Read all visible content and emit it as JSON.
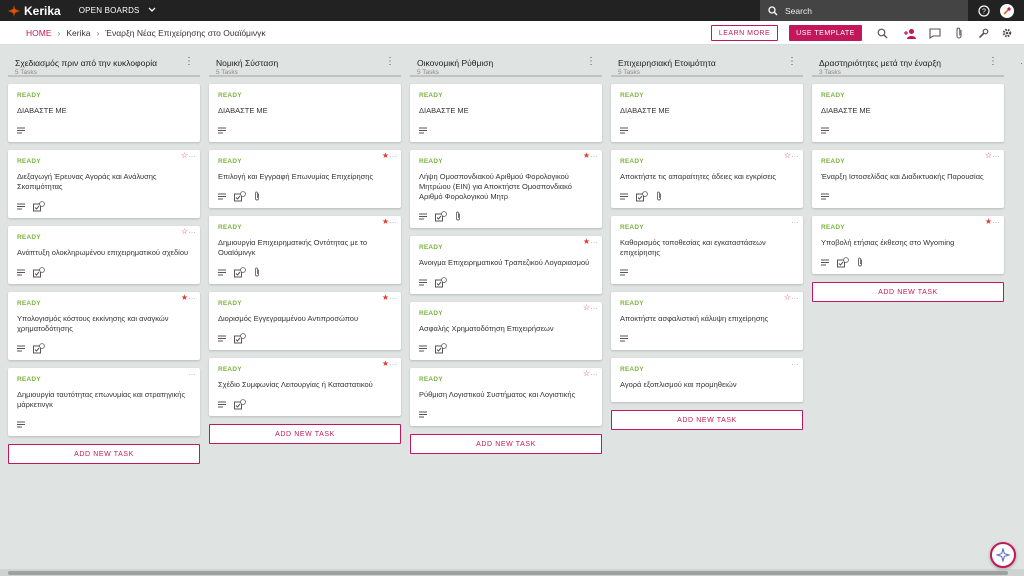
{
  "topbar": {
    "logo": "Kerika",
    "open_boards": "OPEN BOARDS",
    "search_placeholder": "Search"
  },
  "breadcrumb": {
    "home": "HOME",
    "workspace": "Kerika",
    "board": "Έναρξη Νέας Επιχείρησης στο Ουαϊόμινγκ"
  },
  "header_buttons": {
    "learn_more": "LEARN MORE",
    "use_template": "USE TEMPLATE"
  },
  "colors": {
    "accent": "#c2185b",
    "ready": "#7cb342",
    "star_filled": "#e53935"
  },
  "columns": [
    {
      "title": "Σχεδιασμός πριν από την κυκλοφορία",
      "count": "5 Tasks",
      "add_task": "ADD NEW TASK",
      "cards": [
        {
          "status": "READY",
          "title": "ΔΙΑΒΑΣΤΕ ΜΕ",
          "star": "none",
          "icons": [
            "desc"
          ]
        },
        {
          "status": "READY",
          "title": "Διεξαγωγή Έρευνας Αγοράς και Ανάλυσης Σκοπιμότητας",
          "star": "outline",
          "icons": [
            "desc",
            "checklist"
          ]
        },
        {
          "status": "READY",
          "title": "Ανάπτυξη ολοκληρωμένου επιχειρηματικού σχεδίου",
          "star": "outline",
          "icons": [
            "desc",
            "checklist"
          ]
        },
        {
          "status": "READY",
          "title": "Υπολογισμός κόστους εκκίνησης και αναγκών χρηματοδότησης",
          "star": "filled",
          "icons": [
            "desc",
            "checklist"
          ]
        },
        {
          "status": "READY",
          "title": "Δημιουργία ταυτότητας επωνυμίας και στρατηγικής μάρκετινγκ",
          "star": "none",
          "icons": [
            "desc"
          ]
        }
      ]
    },
    {
      "title": "Νομική Σύσταση",
      "count": "5 Tasks",
      "add_task": "ADD NEW TASK",
      "cards": [
        {
          "status": "READY",
          "title": "ΔΙΑΒΑΣΤΕ ΜΕ",
          "star": "none",
          "icons": [
            "desc"
          ]
        },
        {
          "status": "READY",
          "title": "Επιλογή και Εγγραφή Επωνυμίας Επιχείρησης",
          "star": "filled",
          "icons": [
            "desc",
            "checklist",
            "attach"
          ]
        },
        {
          "status": "READY",
          "title": "Δημιουργία Επιχειρηματικής Οντότητας με το Ουαϊόμινγκ",
          "star": "filled",
          "icons": [
            "desc",
            "checklist",
            "attach"
          ]
        },
        {
          "status": "READY",
          "title": "Διορισμός Εγγεγραμμένου Αντιπροσώπου",
          "star": "filled",
          "icons": [
            "desc",
            "checklist"
          ]
        },
        {
          "status": "READY",
          "title": "Σχέδιο Συμφωνίας Λειτουργίας ή Καταστατικού",
          "star": "filled",
          "icons": [
            "desc",
            "checklist"
          ]
        }
      ]
    },
    {
      "title": "Οικονομική Ρύθμιση",
      "count": "5 Tasks",
      "add_task": "ADD NEW TASK",
      "cards": [
        {
          "status": "READY",
          "title": "ΔΙΑΒΑΣΤΕ ΜΕ",
          "star": "none",
          "icons": [
            "desc"
          ]
        },
        {
          "status": "READY",
          "title": "Λήψη Ομοσπονδιακού Αριθμού Φορολογικού Μητρώου (EIN) για Αποκτήστε Ομοσπονδιακό Αριθμό Φορολογικού Μητρ",
          "star": "filled",
          "icons": [
            "desc",
            "checklist",
            "attach"
          ]
        },
        {
          "status": "READY",
          "title": "Άνοιγμα Επιχειρηματικού Τραπεζικού Λογαριασμού",
          "star": "filled",
          "icons": [
            "desc",
            "checklist"
          ]
        },
        {
          "status": "READY",
          "title": "Ασφαλής Χρηματοδότηση Επιχειρήσεων",
          "star": "outline",
          "icons": [
            "desc",
            "checklist"
          ]
        },
        {
          "status": "READY",
          "title": "Ρύθμιση Λογιστικού Συστήματος και Λογιστικής",
          "star": "outline",
          "icons": [
            "desc"
          ]
        }
      ]
    },
    {
      "title": "Επιχειρησιακή Ετοιμότητα",
      "count": "5 Tasks",
      "add_task": "ADD NEW TASK",
      "cards": [
        {
          "status": "READY",
          "title": "ΔΙΑΒΑΣΤΕ ΜΕ",
          "star": "none",
          "icons": [
            "desc"
          ]
        },
        {
          "status": "READY",
          "title": "Αποκτήστε τις απαραίτητες άδειες και εγκρίσεις",
          "star": "outline",
          "icons": [
            "desc",
            "checklist",
            "attach"
          ]
        },
        {
          "status": "READY",
          "title": "Καθορισμός τοποθεσίας και εγκαταστάσεων επιχείρησης",
          "star": "none",
          "icons": [
            "desc"
          ]
        },
        {
          "status": "READY",
          "title": "Αποκτήστε ασφαλιστική κάλυψη επιχείρησης",
          "star": "outline",
          "icons": [
            "desc"
          ]
        },
        {
          "status": "READY",
          "title": "Αγορά εξοπλισμού και προμηθειών",
          "star": "none",
          "icons": []
        }
      ]
    },
    {
      "title": "Δραστηριότητες μετά την έναρξη",
      "count": "3 Tasks",
      "add_task": "ADD NEW TASK",
      "cards": [
        {
          "status": "READY",
          "title": "ΔΙΑΒΑΣΤΕ ΜΕ",
          "star": "none",
          "icons": [
            "desc"
          ]
        },
        {
          "status": "READY",
          "title": "Έναρξη Ιστοσελίδας και Διαδικτυακής Παρουσίας",
          "star": "outline",
          "icons": [
            "desc"
          ]
        },
        {
          "status": "READY",
          "title": "Υποβολή ετήσιας έκθεσης στο Wyoming",
          "star": "filled",
          "icons": [
            "desc",
            "checklist",
            "attach"
          ]
        }
      ]
    }
  ]
}
